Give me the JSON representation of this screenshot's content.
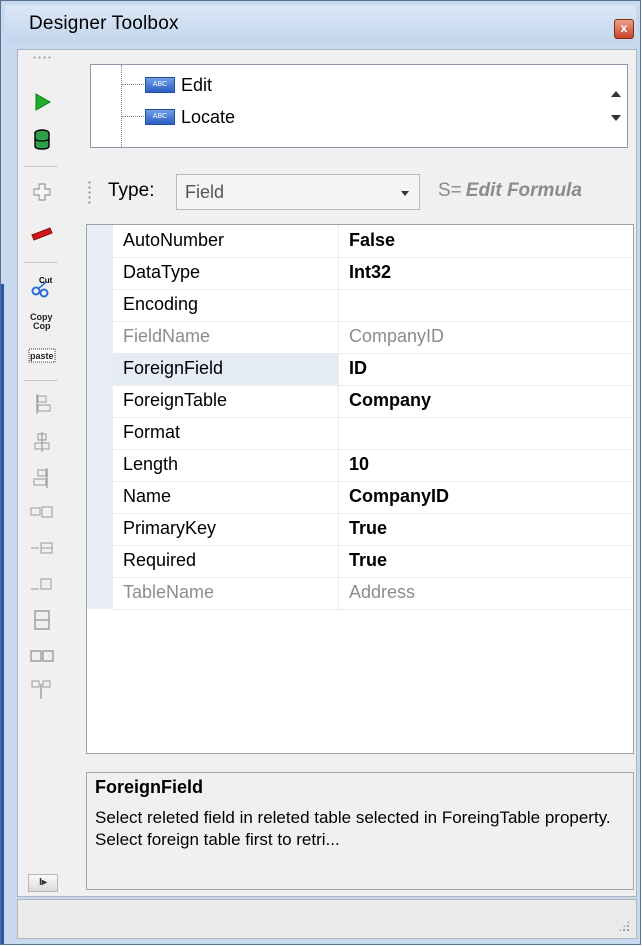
{
  "window": {
    "title": "Designer Toolbox",
    "close_glyph": "x"
  },
  "toolbar": {
    "items": [
      {
        "icon": "run-icon"
      },
      {
        "icon": "database-icon"
      },
      {
        "icon": "add-icon"
      },
      {
        "icon": "remove-icon"
      },
      {
        "icon": "cut-icon",
        "label": "Cut"
      },
      {
        "icon": "copy-icon",
        "label": "Copy"
      },
      {
        "icon": "paste-icon",
        "label": "paste"
      },
      {
        "icon": "align-left-icon"
      },
      {
        "icon": "align-center-icon"
      },
      {
        "icon": "align-right-icon"
      },
      {
        "icon": "label-left-icon"
      },
      {
        "icon": "label-right-icon"
      },
      {
        "icon": "label-bottom-icon"
      },
      {
        "icon": "split-vertical-icon"
      },
      {
        "icon": "split-horizontal-icon"
      },
      {
        "icon": "tree-icon"
      }
    ],
    "expand_glyph": "I▸"
  },
  "tree": {
    "items": [
      {
        "label": "Edit",
        "icon_text": "ABC"
      },
      {
        "label": "Locate",
        "icon_text": "ABC"
      }
    ]
  },
  "typebar": {
    "label": "Type:",
    "value": "Field",
    "formula_prefix": "S=",
    "formula_label": "Edit Formula"
  },
  "properties": [
    {
      "name": "AutoNumber",
      "value": "False",
      "bold": true
    },
    {
      "name": "DataType",
      "value": "Int32",
      "bold": true
    },
    {
      "name": "Encoding",
      "value": "",
      "bold": false
    },
    {
      "name": "FieldName",
      "value": "CompanyID",
      "bold": false,
      "readonly": true
    },
    {
      "name": "ForeignField",
      "value": "ID",
      "bold": true,
      "selected": true
    },
    {
      "name": "ForeignTable",
      "value": "Company",
      "bold": true
    },
    {
      "name": "Format",
      "value": "",
      "bold": false
    },
    {
      "name": "Length",
      "value": "10",
      "bold": true
    },
    {
      "name": "Name",
      "value": "CompanyID",
      "bold": true
    },
    {
      "name": "PrimaryKey",
      "value": "True",
      "bold": true
    },
    {
      "name": "Required",
      "value": "True",
      "bold": true
    },
    {
      "name": "TableName",
      "value": "Address",
      "bold": false,
      "readonly": true
    }
  ],
  "description": {
    "title": "ForeignField",
    "text": "Select releted field in releted table selected in ForeingTable property. Select foreign table first to retri..."
  },
  "colors": {
    "accent": "#2b55a6",
    "titlebar": "#c7d9ef",
    "close": "#c9462c"
  }
}
